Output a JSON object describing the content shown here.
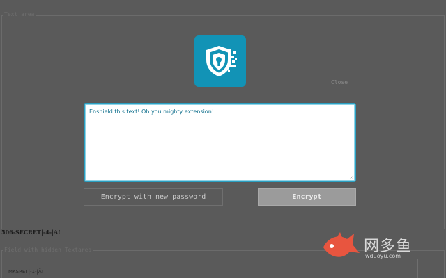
{
  "top_section": {
    "legend": "Text area"
  },
  "logo": {
    "icon": "shield-keyhole-icon",
    "brand_color": "#1293b6"
  },
  "close_link": "Close",
  "editor": {
    "text": "Enshield this text! Oh you mighty extension!"
  },
  "buttons": {
    "new_password": "Encrypt with new password",
    "encrypt": "Encrypt"
  },
  "secret_line": "506-SECRET|-4-|Ā!",
  "bottom_section": {
    "legend": "Field with hidden Textarea",
    "value": "MKSRET|-1-|Ā!"
  },
  "watermark": {
    "text_cn": "网多鱼",
    "url": "wduoyu.com"
  }
}
